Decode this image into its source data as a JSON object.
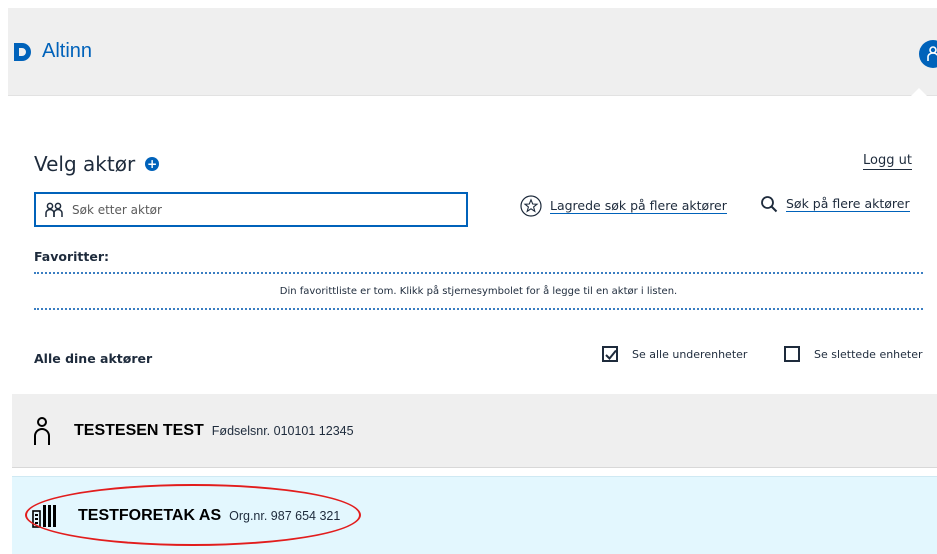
{
  "header": {
    "brand": "Altinn",
    "brand_color": "#0062ba",
    "icons": {
      "logo": "altinn-logo-icon",
      "profile": "user-icon"
    }
  },
  "main": {
    "title": "Velg aktør",
    "logout_label": "Logg ut",
    "search": {
      "placeholder": "Søk etter aktør",
      "value": ""
    },
    "saved_searches_label": "Lagrede søk på flere aktører",
    "multi_search_label": "Søk på flere aktører",
    "favorites": {
      "label": "Favoritter:",
      "empty_text": "Din favorittliste er tom. Klikk på stjernesymbolet for å legge til en aktør i listen."
    },
    "all_actors": {
      "label": "Alle dine aktører",
      "options": [
        {
          "label": "Se alle underenheter",
          "checked": true
        },
        {
          "label": "Se slettede enheter",
          "checked": false
        }
      ]
    },
    "actors": [
      {
        "name": "TESTESEN TEST",
        "id_text": "Fødselsnr. 010101 12345",
        "type": "person"
      },
      {
        "name": "TESTFORETAK AS",
        "id_text": "Org.nr. 987 654 321",
        "type": "organization"
      }
    ]
  }
}
